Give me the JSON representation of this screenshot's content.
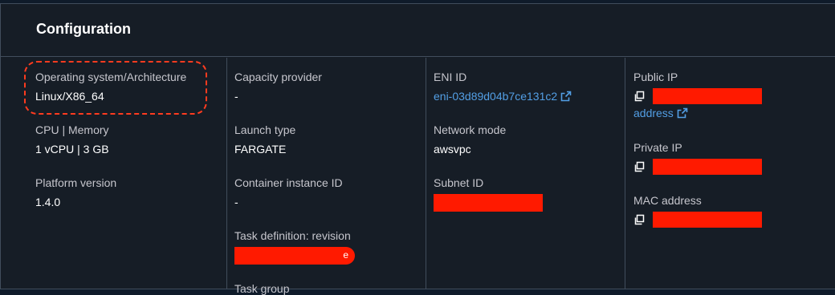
{
  "panel": {
    "title": "Configuration"
  },
  "columns": [
    {
      "fields": [
        {
          "label": "Operating system/Architecture",
          "value": "Linux/X86_64"
        },
        {
          "label": "CPU | Memory",
          "value": "1 vCPU | 3 GB"
        },
        {
          "label": "Platform version",
          "value": "1.4.0"
        }
      ]
    },
    {
      "fields": [
        {
          "label": "Capacity provider",
          "value": "-"
        },
        {
          "label": "Launch type",
          "value": "FARGATE"
        },
        {
          "label": "Container instance ID",
          "value": "-"
        },
        {
          "label": "Task definition: revision",
          "value": "e"
        },
        {
          "label": "Task group",
          "value": ""
        }
      ]
    },
    {
      "fields": [
        {
          "label": "ENI ID",
          "value": "eni-03d89d04b7ce131c2"
        },
        {
          "label": "Network mode",
          "value": "awsvpc"
        },
        {
          "label": "Subnet ID",
          "value": ""
        }
      ]
    },
    {
      "fields": [
        {
          "label": "Public IP",
          "value": "",
          "link": "address"
        },
        {
          "label": "Private IP",
          "value": ""
        },
        {
          "label": "MAC address",
          "value": ""
        }
      ]
    }
  ],
  "colors": {
    "panel_bg": "#161d26",
    "border": "#414d5c",
    "link": "#539fe5",
    "redaction": "#ff1a00",
    "highlight": "#ff3b1f"
  },
  "icons": {
    "external_link": "external-link-icon",
    "copy": "copy-icon"
  }
}
